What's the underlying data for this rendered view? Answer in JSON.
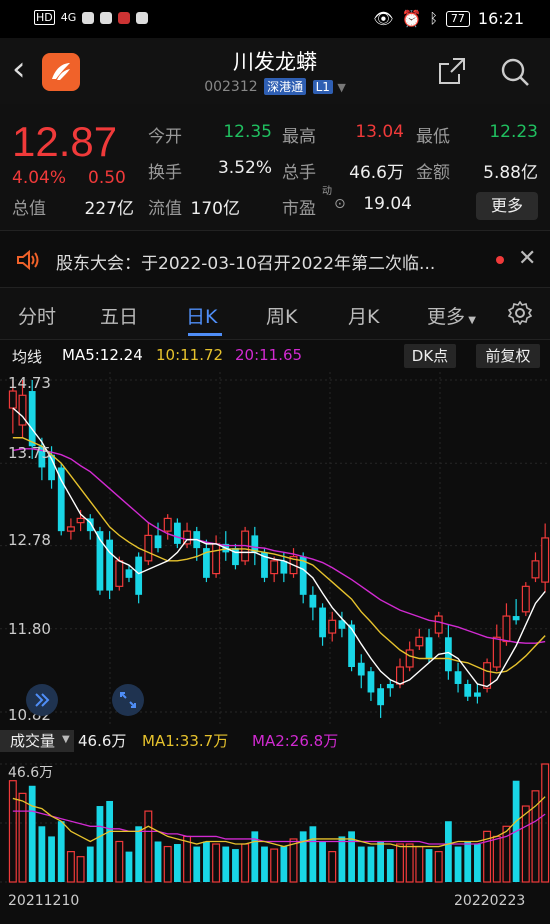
{
  "status": {
    "time": "16:21",
    "battery": "77",
    "hd": "HD",
    "signal": "4G"
  },
  "header": {
    "title": "川发龙蟒",
    "code": "002312",
    "tag1": "深港通",
    "tag2": "L1"
  },
  "quote": {
    "price": "12.87",
    "pct": "4.04%",
    "chg": "0.50",
    "fields": [
      {
        "label": "今开",
        "value": "12.35",
        "color": "green"
      },
      {
        "label": "最高",
        "value": "13.04",
        "color": "red"
      },
      {
        "label": "最低",
        "value": "12.23",
        "color": "green"
      },
      {
        "label": "换手",
        "value": "3.52%",
        "color": "white"
      },
      {
        "label": "总手",
        "value": "46.6万",
        "color": "white"
      },
      {
        "label": "金额",
        "value": "5.88亿",
        "color": "white"
      },
      {
        "label": "总值",
        "value": "227亿",
        "color": "white"
      },
      {
        "label": "流值",
        "value": "170亿",
        "color": "white"
      },
      {
        "label": "市盈",
        "value": "19.04",
        "color": "white"
      }
    ],
    "pe_sup": "动",
    "more": "更多"
  },
  "notice": {
    "text": "股东大会：于2022-03-10召开2022年第二次临..."
  },
  "tabs": [
    "分时",
    "五日",
    "日K",
    "周K",
    "月K",
    "更多"
  ],
  "active_tab": "日K",
  "ma": {
    "label": "均线",
    "ma5": "MA5:12.24",
    "ma10": "10:11.72",
    "ma20": "20:11.65",
    "dk": "DK点",
    "fq": "前复权"
  },
  "volume": {
    "label": "成交量",
    "value": "46.6万",
    "ma1": "MA1:33.7万",
    "ma2": "MA2:26.8万",
    "max": "46.6万"
  },
  "axis": {
    "y1": "14.73",
    "y2": "13.75",
    "y3": "12.78",
    "y4": "11.80",
    "y5": "10.82"
  },
  "dates": {
    "start": "20211210",
    "end": "20220223"
  },
  "colors": {
    "up": "#f03a3a",
    "down": "#19d6e6",
    "ma5": "#ffffff",
    "ma10": "#e6c22d",
    "ma20": "#d12ad1"
  },
  "chart_data": {
    "type": "candlestick",
    "ylim": [
      10.82,
      14.73
    ],
    "candles": [
      [
        14.4,
        14.6,
        14.73,
        14.1
      ],
      [
        14.2,
        14.55,
        14.73,
        14.05
      ],
      [
        14.6,
        13.95,
        14.73,
        13.8
      ],
      [
        13.95,
        13.7,
        14.05,
        13.55
      ],
      [
        13.85,
        13.55,
        13.95,
        13.45
      ],
      [
        13.7,
        12.95,
        13.75,
        12.9
      ],
      [
        12.95,
        13.0,
        13.1,
        12.85
      ],
      [
        13.05,
        13.1,
        13.2,
        12.95
      ],
      [
        13.1,
        12.95,
        13.15,
        12.85
      ],
      [
        12.95,
        12.25,
        13.0,
        12.2
      ],
      [
        12.85,
        12.25,
        12.95,
        12.15
      ],
      [
        12.3,
        12.6,
        12.65,
        12.25
      ],
      [
        12.5,
        12.4,
        12.55,
        12.35
      ],
      [
        12.65,
        12.2,
        12.7,
        12.1
      ],
      [
        12.6,
        12.9,
        13.05,
        12.55
      ],
      [
        12.9,
        12.75,
        13.05,
        12.7
      ],
      [
        12.95,
        13.1,
        13.15,
        12.85
      ],
      [
        13.05,
        12.8,
        13.1,
        12.75
      ],
      [
        12.8,
        12.95,
        13.05,
        12.75
      ],
      [
        12.95,
        12.75,
        13.0,
        12.6
      ],
      [
        12.75,
        12.4,
        12.85,
        12.35
      ],
      [
        12.45,
        12.8,
        12.9,
        12.4
      ],
      [
        12.8,
        12.7,
        12.95,
        12.6
      ],
      [
        12.75,
        12.55,
        12.8,
        12.5
      ],
      [
        12.6,
        12.95,
        13.0,
        12.55
      ],
      [
        12.9,
        12.7,
        13.0,
        12.55
      ],
      [
        12.7,
        12.4,
        12.75,
        12.35
      ],
      [
        12.45,
        12.6,
        12.65,
        12.35
      ],
      [
        12.6,
        12.45,
        12.7,
        12.35
      ],
      [
        12.45,
        12.65,
        12.75,
        12.4
      ],
      [
        12.65,
        12.2,
        12.7,
        12.1
      ],
      [
        12.2,
        12.05,
        12.3,
        11.9
      ],
      [
        12.05,
        11.7,
        12.1,
        11.6
      ],
      [
        11.75,
        11.9,
        12.0,
        11.65
      ],
      [
        11.9,
        11.8,
        12.0,
        11.7
      ],
      [
        11.85,
        11.35,
        11.9,
        11.3
      ],
      [
        11.4,
        11.25,
        11.5,
        11.1
      ],
      [
        11.3,
        11.05,
        11.35,
        10.95
      ],
      [
        11.1,
        10.9,
        11.15,
        10.75
      ],
      [
        11.15,
        11.1,
        11.2,
        11.0
      ],
      [
        11.15,
        11.35,
        11.45,
        11.1
      ],
      [
        11.35,
        11.55,
        11.65,
        11.3
      ],
      [
        11.6,
        11.7,
        11.8,
        11.55
      ],
      [
        11.7,
        11.45,
        11.8,
        11.4
      ],
      [
        11.75,
        11.95,
        12.0,
        11.7
      ],
      [
        11.7,
        11.3,
        11.85,
        11.2
      ],
      [
        11.3,
        11.15,
        11.4,
        11.05
      ],
      [
        11.15,
        11.0,
        11.2,
        10.95
      ],
      [
        11.05,
        11.0,
        11.15,
        10.92
      ],
      [
        11.1,
        11.4,
        11.45,
        11.05
      ],
      [
        11.35,
        11.7,
        11.85,
        11.3
      ],
      [
        11.65,
        11.95,
        12.1,
        11.6
      ],
      [
        11.95,
        11.9,
        12.15,
        11.85
      ],
      [
        12.0,
        12.3,
        12.35,
        11.95
      ],
      [
        12.4,
        12.6,
        12.7,
        12.35
      ],
      [
        12.35,
        12.87,
        13.04,
        12.23
      ]
    ],
    "ma5": [
      14.4,
      14.3,
      14.15,
      14.0,
      13.8,
      13.55,
      13.35,
      13.15,
      13.05,
      12.85,
      12.7,
      12.6,
      12.55,
      12.45,
      12.5,
      12.55,
      12.6,
      12.7,
      12.85,
      12.85,
      12.8,
      12.8,
      12.75,
      12.7,
      12.7,
      12.7,
      12.65,
      12.62,
      12.6,
      12.55,
      12.5,
      12.4,
      12.22,
      12.05,
      11.92,
      11.8,
      11.62,
      11.45,
      11.3,
      11.2,
      11.15,
      11.2,
      11.3,
      11.4,
      11.5,
      11.52,
      11.45,
      11.3,
      11.15,
      11.12,
      11.2,
      11.4,
      11.6,
      11.85,
      12.1,
      12.24
    ],
    "ma10": [
      14.05,
      14.05,
      14.0,
      13.95,
      13.85,
      13.75,
      13.6,
      13.45,
      13.3,
      13.15,
      13.0,
      12.9,
      12.82,
      12.75,
      12.7,
      12.65,
      12.6,
      12.6,
      12.62,
      12.65,
      12.7,
      12.72,
      12.74,
      12.74,
      12.74,
      12.72,
      12.7,
      12.68,
      12.65,
      12.62,
      12.6,
      12.55,
      12.45,
      12.35,
      12.25,
      12.15,
      12.0,
      11.88,
      11.75,
      11.65,
      11.55,
      11.48,
      11.45,
      11.45,
      11.45,
      11.45,
      11.42,
      11.4,
      11.35,
      11.3,
      11.28,
      11.3,
      11.38,
      11.48,
      11.6,
      11.72
    ],
    "ma20": [
      13.9,
      13.92,
      13.92,
      13.9,
      13.88,
      13.85,
      13.8,
      13.72,
      13.65,
      13.55,
      13.45,
      13.35,
      13.25,
      13.15,
      13.05,
      12.98,
      12.92,
      12.88,
      12.85,
      12.85,
      12.82,
      12.8,
      12.78,
      12.78,
      12.78,
      12.76,
      12.75,
      12.72,
      12.7,
      12.68,
      12.65,
      12.62,
      12.58,
      12.52,
      12.45,
      12.38,
      12.3,
      12.22,
      12.14,
      12.08,
      12.02,
      11.98,
      11.94,
      11.9,
      11.88,
      11.85,
      11.82,
      11.78,
      11.74,
      11.7,
      11.68,
      11.66,
      11.64,
      11.63,
      11.63,
      11.65
    ],
    "volumes_wan": [
      40,
      35,
      38,
      22,
      18,
      24,
      12,
      10,
      14,
      30,
      32,
      16,
      12,
      22,
      28,
      16,
      14,
      15,
      18,
      14,
      16,
      15,
      14,
      13,
      15,
      20,
      14,
      13,
      14,
      17,
      20,
      22,
      16,
      12,
      18,
      20,
      14,
      14,
      16,
      13,
      15,
      15,
      14,
      13,
      12,
      24,
      14,
      16,
      15,
      20,
      18,
      22,
      40,
      30,
      36,
      46.6
    ],
    "vol_ma1": [
      33,
      32,
      30,
      29,
      26,
      24,
      20,
      18,
      16,
      18,
      20,
      20,
      20,
      20,
      22,
      20,
      18,
      17,
      16,
      15,
      16,
      16,
      16,
      15,
      15,
      16,
      16,
      15,
      14,
      15,
      16,
      17,
      17,
      17,
      17,
      17,
      16,
      15,
      15,
      15,
      14,
      14,
      14,
      14,
      14,
      15,
      16,
      16,
      16,
      17,
      18,
      20,
      24,
      27,
      30,
      33.7
    ],
    "vol_ma2": [
      28,
      28,
      28,
      27,
      26,
      25,
      24,
      23,
      22,
      22,
      21,
      21,
      20,
      20,
      20,
      20,
      19,
      19,
      18,
      18,
      18,
      18,
      17,
      17,
      17,
      17,
      16,
      16,
      16,
      16,
      16,
      16,
      16,
      16,
      16,
      16,
      16,
      16,
      16,
      16,
      16,
      16,
      16,
      15,
      15,
      15,
      15,
      15,
      15,
      16,
      17,
      18,
      20,
      22,
      24,
      26.8
    ]
  }
}
